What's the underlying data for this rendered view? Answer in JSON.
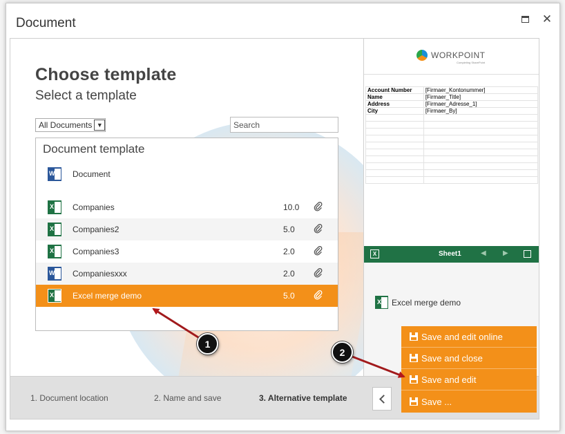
{
  "dialog": {
    "title": "Document",
    "heading": "Choose template",
    "subheading": "Select a template"
  },
  "filter": {
    "selected": "All Documents",
    "search_placeholder": "Search"
  },
  "list": {
    "title": "Document template",
    "rows": [
      {
        "type": "word",
        "name": "Document",
        "version": "",
        "attachment": false
      },
      {
        "type": "excel",
        "name": "Companies",
        "version": "10.0",
        "attachment": true
      },
      {
        "type": "excel",
        "name": "Companies2",
        "version": "5.0",
        "attachment": true
      },
      {
        "type": "excel",
        "name": "Companies3",
        "version": "2.0",
        "attachment": true
      },
      {
        "type": "word",
        "name": "Companiesxxx",
        "version": "2.0",
        "attachment": true
      },
      {
        "type": "excel",
        "name": "Excel merge demo",
        "version": "5.0",
        "attachment": true
      }
    ]
  },
  "preview": {
    "logo_text": "WORKPOINT",
    "logo_sub": "Completing SharePoint",
    "sheet_rows": [
      {
        "key": "Account Number",
        "value": "[Firmaer_Kontonummer]"
      },
      {
        "key": "Name",
        "value": "[Firmaer_Title]"
      },
      {
        "key": "Address",
        "value": "[Firmaer_Adresse_1]"
      },
      {
        "key": "City",
        "value": "[Firmaer_By]"
      }
    ],
    "sheet_tab": "Sheet1",
    "selected_name": "Excel merge demo"
  },
  "steps": {
    "s1": "1. Document location",
    "s2": "2. Name and save",
    "s3": "3. Alternative template"
  },
  "menu": {
    "items": [
      "Save and edit online",
      "Save and close",
      "Save and edit",
      "Save ..."
    ]
  },
  "callouts": {
    "c1": "1",
    "c2": "2"
  },
  "colors": {
    "accent": "#f39019",
    "excel": "#1f7244",
    "word": "#2b579a"
  }
}
